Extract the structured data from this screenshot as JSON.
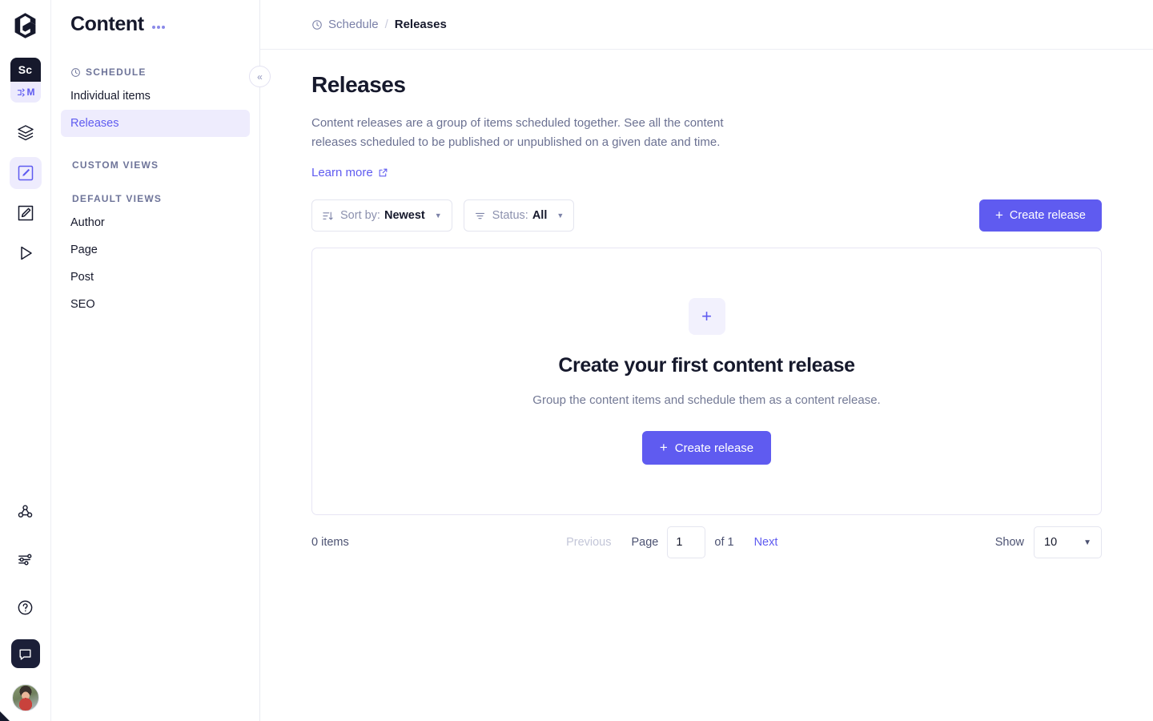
{
  "theme": {
    "accent": "#5f5bf0",
    "accent_soft": "#eeecfd",
    "text_dark": "#16192c",
    "text_muted": "#6b7192",
    "border": "#e4e5ef",
    "dark_chip": "#16192c"
  },
  "rail": {
    "logo": "graphcms-logo-icon",
    "project_badge": {
      "top_label": "Sc",
      "bottom_label": "M",
      "bottom_icon": "branch-icon"
    },
    "items": [
      {
        "name": "schema-icon",
        "label": "Schema",
        "active": false
      },
      {
        "name": "content-edit-icon",
        "label": "Content",
        "active": true
      },
      {
        "name": "assets-icon",
        "label": "Assets",
        "active": false
      },
      {
        "name": "api-playground-icon",
        "label": "API Playground",
        "active": false
      }
    ],
    "bottom_items": [
      {
        "name": "webhooks-icon",
        "label": "Webhooks"
      },
      {
        "name": "settings-sliders-icon",
        "label": "Settings"
      },
      {
        "name": "help-circle-icon",
        "label": "Help"
      },
      {
        "name": "chat-icon",
        "label": "Chat"
      },
      {
        "name": "avatar",
        "label": "User avatar"
      }
    ]
  },
  "sidebar": {
    "title": "Content",
    "more_menu": "more-options-icon",
    "collapse_icon": "«",
    "sections": [
      {
        "label": "SCHEDULE",
        "icon": "clock-icon",
        "items": [
          {
            "label": "Individual items",
            "active": false
          },
          {
            "label": "Releases",
            "active": true
          }
        ]
      },
      {
        "label": "CUSTOM VIEWS",
        "icon": null,
        "items": []
      },
      {
        "label": "DEFAULT VIEWS",
        "icon": null,
        "items": [
          {
            "label": "Author",
            "active": false
          },
          {
            "label": "Page",
            "active": false
          },
          {
            "label": "Post",
            "active": false
          },
          {
            "label": "SEO",
            "active": false
          }
        ]
      }
    ]
  },
  "breadcrumb": {
    "icon": "clock-icon",
    "parent": "Schedule",
    "separator": "/",
    "current": "Releases"
  },
  "page": {
    "title": "Releases",
    "description": "Content releases are a group of items scheduled together. See all the content releases scheduled to be published or unpublished on a given date and time.",
    "learn_more": "Learn more",
    "learn_more_icon": "external-link-icon"
  },
  "toolbar": {
    "sort": {
      "icon": "sort-icon",
      "prefix": "Sort by:",
      "value": "Newest",
      "caret": "caret-down-icon"
    },
    "status": {
      "icon": "filter-icon",
      "prefix": "Status:",
      "value": "All",
      "caret": "caret-down-icon"
    },
    "create_button": {
      "label": "Create release",
      "icon": "plus-icon"
    }
  },
  "empty_state": {
    "icon": "plus-icon",
    "title": "Create your first content release",
    "subtitle": "Group the content items and schedule them as a content release.",
    "button": {
      "label": "Create release",
      "icon": "plus-icon"
    }
  },
  "pagination": {
    "items_count": "0 items",
    "previous": "Previous",
    "page_label": "Page",
    "page_value": "1",
    "of_label": "of 1",
    "next": "Next",
    "show_label": "Show",
    "show_value": "10",
    "caret": "caret-down-icon"
  }
}
